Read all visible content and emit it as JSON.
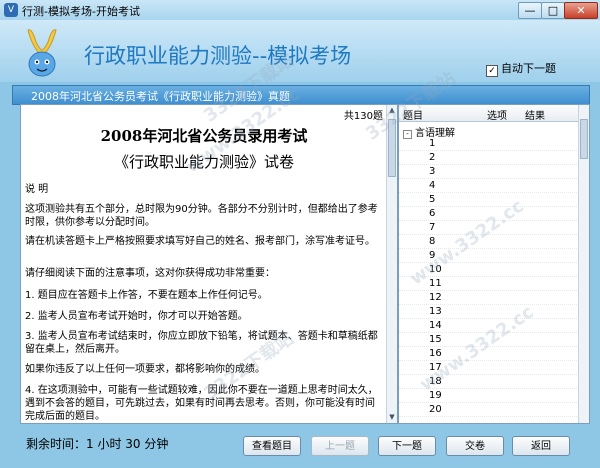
{
  "window": {
    "title": "行测-模拟考场-开始考试",
    "min_glyph": "—",
    "max_glyph": "□",
    "close_glyph": "✕"
  },
  "header": {
    "app_title": "行政职业能力测验--模拟考场",
    "auto_next_label": "自动下一题",
    "auto_next_checked": true
  },
  "exam_bar": {
    "text": "2008年河北省公务员考试《行政职业能力测验》真题"
  },
  "question": {
    "total": "共130题",
    "title": "2008年河北省公务员录用考试",
    "subtitle": "《行政职业能力测验》试卷",
    "paragraphs": [
      "说 明",
      "这项测验共有五个部分，总时限为90分钟。各部分不分别计时，但都给出了参考时限，供你参考以分配时间。",
      "请在机读答题卡上严格按照要求填写好自己的姓名、报考部门，涂写准考证号。",
      "请仔细阅读下面的注意事项，这对你获得成功非常重要：",
      "1. 题目应在答题卡上作答，不要在题本上作任何记号。",
      "2. 监考人员宣布考试开始时，你才可以开始答题。",
      "3. 监考人员宣布考试结束时，你应立即放下铅笔，将试题本、答题卡和草稿纸都留在桌上，然后离开。",
      "如果你违反了以上任何一项要求，都将影响你的成绩。",
      "4. 在这项测验中，可能有一些试题较难，因此你不要在一道题上思考时间太久，遇到不会答的题目，可先跳过去，如果有时间再去思考。否则，你可能没有时间完成后面的题目。"
    ]
  },
  "answers": {
    "col_question": "题目",
    "col_option": "选项",
    "col_result": "结果",
    "category": "言语理解",
    "category_toggle": "-",
    "rows": [
      "1",
      "2",
      "3",
      "4",
      "5",
      "6",
      "7",
      "8",
      "9",
      "10",
      "11",
      "12",
      "13",
      "14",
      "15",
      "16",
      "17",
      "18",
      "19",
      "20"
    ]
  },
  "footer": {
    "timer_label": "剩余时间：",
    "timer_value": "1 小时 30 分钟",
    "buttons": [
      "查看题目",
      "上一题",
      "下一题",
      "交卷",
      "返回"
    ]
  },
  "watermark": "3322下载站",
  "watermark2": "www.3322.cc",
  "colors": {
    "title_blue": "#1e79c2",
    "bar_blue": "#3f8fd0",
    "background": "#8ec7e6"
  }
}
